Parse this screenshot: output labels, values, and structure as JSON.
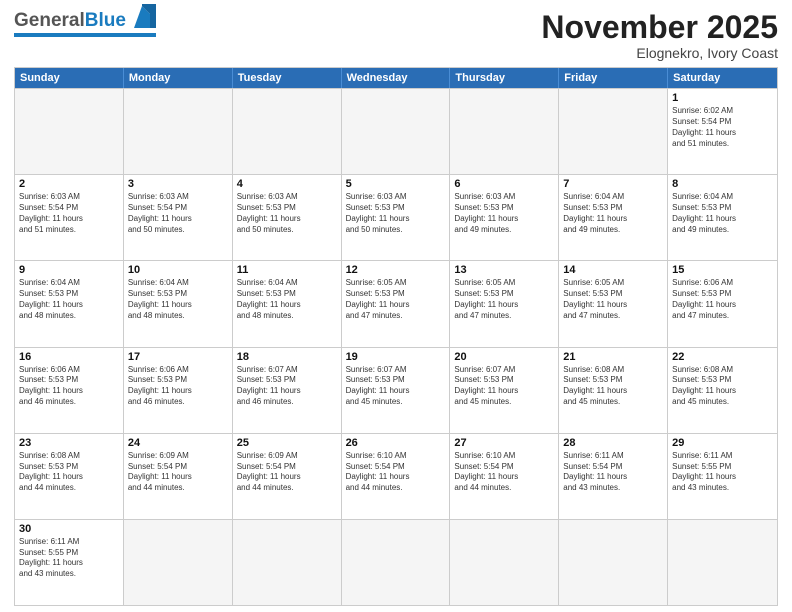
{
  "header": {
    "logo_general": "General",
    "logo_blue": "Blue",
    "month_title": "November 2025",
    "location": "Elognekro, Ivory Coast"
  },
  "weekdays": [
    "Sunday",
    "Monday",
    "Tuesday",
    "Wednesday",
    "Thursday",
    "Friday",
    "Saturday"
  ],
  "weeks": [
    [
      {
        "day": "",
        "info": ""
      },
      {
        "day": "",
        "info": ""
      },
      {
        "day": "",
        "info": ""
      },
      {
        "day": "",
        "info": ""
      },
      {
        "day": "",
        "info": ""
      },
      {
        "day": "",
        "info": ""
      },
      {
        "day": "1",
        "info": "Sunrise: 6:02 AM\nSunset: 5:54 PM\nDaylight: 11 hours\nand 51 minutes."
      }
    ],
    [
      {
        "day": "2",
        "info": "Sunrise: 6:03 AM\nSunset: 5:54 PM\nDaylight: 11 hours\nand 51 minutes."
      },
      {
        "day": "3",
        "info": "Sunrise: 6:03 AM\nSunset: 5:54 PM\nDaylight: 11 hours\nand 50 minutes."
      },
      {
        "day": "4",
        "info": "Sunrise: 6:03 AM\nSunset: 5:53 PM\nDaylight: 11 hours\nand 50 minutes."
      },
      {
        "day": "5",
        "info": "Sunrise: 6:03 AM\nSunset: 5:53 PM\nDaylight: 11 hours\nand 50 minutes."
      },
      {
        "day": "6",
        "info": "Sunrise: 6:03 AM\nSunset: 5:53 PM\nDaylight: 11 hours\nand 49 minutes."
      },
      {
        "day": "7",
        "info": "Sunrise: 6:04 AM\nSunset: 5:53 PM\nDaylight: 11 hours\nand 49 minutes."
      },
      {
        "day": "8",
        "info": "Sunrise: 6:04 AM\nSunset: 5:53 PM\nDaylight: 11 hours\nand 49 minutes."
      }
    ],
    [
      {
        "day": "9",
        "info": "Sunrise: 6:04 AM\nSunset: 5:53 PM\nDaylight: 11 hours\nand 48 minutes."
      },
      {
        "day": "10",
        "info": "Sunrise: 6:04 AM\nSunset: 5:53 PM\nDaylight: 11 hours\nand 48 minutes."
      },
      {
        "day": "11",
        "info": "Sunrise: 6:04 AM\nSunset: 5:53 PM\nDaylight: 11 hours\nand 48 minutes."
      },
      {
        "day": "12",
        "info": "Sunrise: 6:05 AM\nSunset: 5:53 PM\nDaylight: 11 hours\nand 47 minutes."
      },
      {
        "day": "13",
        "info": "Sunrise: 6:05 AM\nSunset: 5:53 PM\nDaylight: 11 hours\nand 47 minutes."
      },
      {
        "day": "14",
        "info": "Sunrise: 6:05 AM\nSunset: 5:53 PM\nDaylight: 11 hours\nand 47 minutes."
      },
      {
        "day": "15",
        "info": "Sunrise: 6:06 AM\nSunset: 5:53 PM\nDaylight: 11 hours\nand 47 minutes."
      }
    ],
    [
      {
        "day": "16",
        "info": "Sunrise: 6:06 AM\nSunset: 5:53 PM\nDaylight: 11 hours\nand 46 minutes."
      },
      {
        "day": "17",
        "info": "Sunrise: 6:06 AM\nSunset: 5:53 PM\nDaylight: 11 hours\nand 46 minutes."
      },
      {
        "day": "18",
        "info": "Sunrise: 6:07 AM\nSunset: 5:53 PM\nDaylight: 11 hours\nand 46 minutes."
      },
      {
        "day": "19",
        "info": "Sunrise: 6:07 AM\nSunset: 5:53 PM\nDaylight: 11 hours\nand 45 minutes."
      },
      {
        "day": "20",
        "info": "Sunrise: 6:07 AM\nSunset: 5:53 PM\nDaylight: 11 hours\nand 45 minutes."
      },
      {
        "day": "21",
        "info": "Sunrise: 6:08 AM\nSunset: 5:53 PM\nDaylight: 11 hours\nand 45 minutes."
      },
      {
        "day": "22",
        "info": "Sunrise: 6:08 AM\nSunset: 5:53 PM\nDaylight: 11 hours\nand 45 minutes."
      }
    ],
    [
      {
        "day": "23",
        "info": "Sunrise: 6:08 AM\nSunset: 5:53 PM\nDaylight: 11 hours\nand 44 minutes."
      },
      {
        "day": "24",
        "info": "Sunrise: 6:09 AM\nSunset: 5:54 PM\nDaylight: 11 hours\nand 44 minutes."
      },
      {
        "day": "25",
        "info": "Sunrise: 6:09 AM\nSunset: 5:54 PM\nDaylight: 11 hours\nand 44 minutes."
      },
      {
        "day": "26",
        "info": "Sunrise: 6:10 AM\nSunset: 5:54 PM\nDaylight: 11 hours\nand 44 minutes."
      },
      {
        "day": "27",
        "info": "Sunrise: 6:10 AM\nSunset: 5:54 PM\nDaylight: 11 hours\nand 44 minutes."
      },
      {
        "day": "28",
        "info": "Sunrise: 6:11 AM\nSunset: 5:54 PM\nDaylight: 11 hours\nand 43 minutes."
      },
      {
        "day": "29",
        "info": "Sunrise: 6:11 AM\nSunset: 5:55 PM\nDaylight: 11 hours\nand 43 minutes."
      }
    ],
    [
      {
        "day": "30",
        "info": "Sunrise: 6:11 AM\nSunset: 5:55 PM\nDaylight: 11 hours\nand 43 minutes."
      },
      {
        "day": "",
        "info": ""
      },
      {
        "day": "",
        "info": ""
      },
      {
        "day": "",
        "info": ""
      },
      {
        "day": "",
        "info": ""
      },
      {
        "day": "",
        "info": ""
      },
      {
        "day": "",
        "info": ""
      }
    ]
  ]
}
